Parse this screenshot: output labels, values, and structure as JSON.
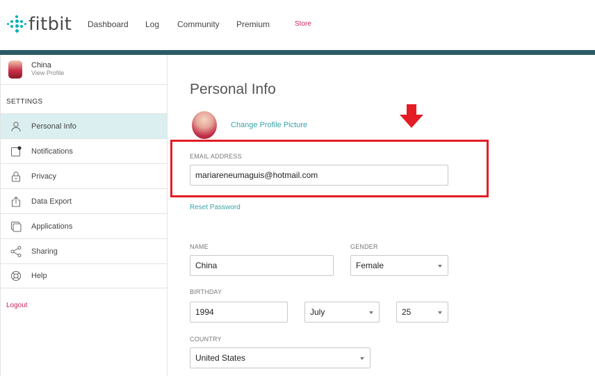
{
  "brand": {
    "name": "fitbit",
    "accent": "#00b0b9",
    "bar_color": "#2b5b66",
    "store_color": "#c8245a"
  },
  "nav": {
    "dashboard": "Dashboard",
    "log": "Log",
    "community": "Community",
    "premium": "Premium",
    "store": "Store"
  },
  "sidebar": {
    "user_name": "China",
    "view_profile": "View Profile",
    "settings_header": "SETTINGS",
    "items": [
      {
        "label": "Personal Info",
        "icon": "person-icon",
        "active": true
      },
      {
        "label": "Notifications",
        "icon": "notifications-icon"
      },
      {
        "label": "Privacy",
        "icon": "lock-icon"
      },
      {
        "label": "Data Export",
        "icon": "export-icon"
      },
      {
        "label": "Applications",
        "icon": "applications-icon"
      },
      {
        "label": "Sharing",
        "icon": "share-icon"
      },
      {
        "label": "Help",
        "icon": "help-lifebuoy-icon"
      }
    ],
    "logout": "Logout"
  },
  "main": {
    "title": "Personal Info",
    "change_picture": "Change Profile Picture",
    "email": {
      "label": "EMAIL ADDRESS",
      "value": "mariareneumaguis@hotmail.com"
    },
    "reset_password": "Reset Password",
    "name": {
      "label": "NAME",
      "value": "China"
    },
    "gender": {
      "label": "GENDER",
      "value": "Female"
    },
    "birthday": {
      "label": "BIRTHDAY",
      "year": "1994",
      "month": "July",
      "day": "25"
    },
    "country": {
      "label": "COUNTRY",
      "value": "United States"
    }
  },
  "annotation": {
    "highlight_color": "#e41c24",
    "arrow_icon": "red-down-arrow-icon"
  }
}
